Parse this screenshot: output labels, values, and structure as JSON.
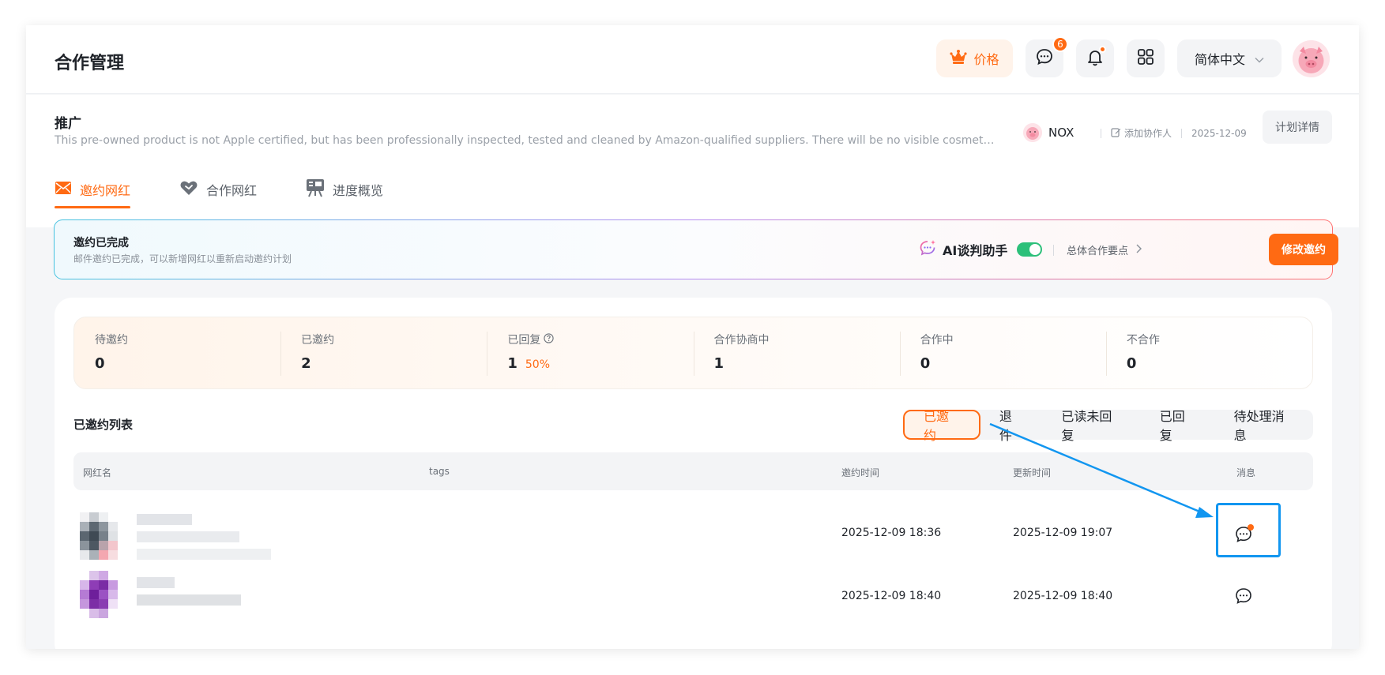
{
  "header": {
    "title": "合作管理",
    "price_label": "价格",
    "message_badge": "6",
    "language": "简体中文"
  },
  "campaign": {
    "title": "推广",
    "description": "This pre-owned product is not Apple certified, but has been professionally inspected, tested and cleaned by Amazon-qualified suppliers. There will be no visible cosmetic imperfection…",
    "brand": "NOX",
    "add_collaborator": "添加协作人",
    "date": "2025-12-09",
    "plan_details": "计划详情",
    "tabs": [
      {
        "label": "邀约网红",
        "active": true
      },
      {
        "label": "合作网红",
        "active": false
      },
      {
        "label": "进度概览",
        "active": false
      }
    ]
  },
  "banner": {
    "title": "邀约已完成",
    "subtitle": "邮件邀约已完成，可以新增网红以重新启动邀约计划",
    "ai_label": "AI谈判助手",
    "ai_enabled": true,
    "points_label": "总体合作要点",
    "modify_button": "修改邀约"
  },
  "stats": [
    {
      "label": "待邀约",
      "value": "0"
    },
    {
      "label": "已邀约",
      "value": "2"
    },
    {
      "label": "已回复",
      "value": "1",
      "pct": "50%"
    },
    {
      "label": "合作协商中",
      "value": "1"
    },
    {
      "label": "合作中",
      "value": "0"
    },
    {
      "label": "不合作",
      "value": "0"
    }
  ],
  "list": {
    "title": "已邀约列表",
    "filters": [
      {
        "label": "已邀约",
        "active": true
      },
      {
        "label": "退件",
        "active": false
      },
      {
        "label": "已读未回复",
        "active": false
      },
      {
        "label": "已回复",
        "active": false
      },
      {
        "label": "待处理消息",
        "active": false
      }
    ],
    "columns": [
      "网红名",
      "tags",
      "邀约时间",
      "更新时间",
      "消息"
    ],
    "rows": [
      {
        "invite_time": "2025-12-09 18:36",
        "update_time": "2025-12-09 19:07",
        "unread": true
      },
      {
        "invite_time": "2025-12-09 18:40",
        "update_time": "2025-12-09 18:40",
        "unread": false
      }
    ]
  },
  "colors": {
    "accent": "#ff6a13",
    "success": "#2cc07a",
    "highlight": "#1296f0"
  },
  "icons": [
    "crown-icon",
    "chat-icon",
    "bell-icon",
    "grid-icon",
    "chevron-down-icon",
    "edit-icon",
    "envelope-icon",
    "handshake-icon",
    "presentation-icon",
    "ai-chat-icon",
    "chevron-right-icon",
    "help-circle-icon"
  ]
}
